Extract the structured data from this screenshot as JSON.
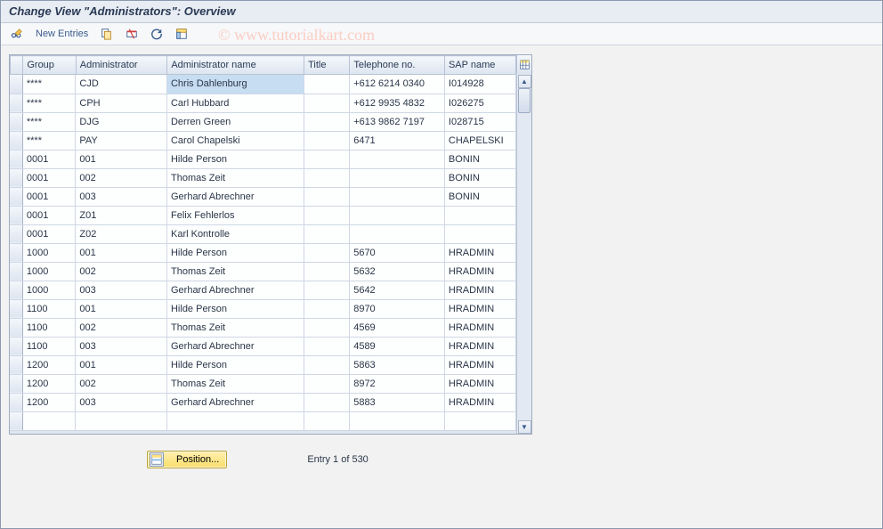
{
  "window_title": "Change View \"Administrators\": Overview",
  "watermark": "© www.tutorialkart.com",
  "toolbar": {
    "new_entries_label": "New Entries"
  },
  "columns": {
    "group": "Group",
    "admin": "Administrator",
    "name": "Administrator name",
    "title": "Title",
    "tel": "Telephone no.",
    "sap": "SAP name"
  },
  "rows": [
    {
      "group": "****",
      "admin": "CJD",
      "name": "Chris Dahlenburg",
      "title": "",
      "tel": "+612 6214 0340",
      "sap": "I014928"
    },
    {
      "group": "****",
      "admin": "CPH",
      "name": "Carl Hubbard",
      "title": "",
      "tel": "+612 9935 4832",
      "sap": "I026275"
    },
    {
      "group": "****",
      "admin": "DJG",
      "name": "Derren Green",
      "title": "",
      "tel": "+613 9862 7197",
      "sap": "I028715"
    },
    {
      "group": "****",
      "admin": "PAY",
      "name": "Carol Chapelski",
      "title": "",
      "tel": "6471",
      "sap": "CHAPELSKI"
    },
    {
      "group": "0001",
      "admin": "001",
      "name": "Hilde Person",
      "title": "",
      "tel": "",
      "sap": "BONIN"
    },
    {
      "group": "0001",
      "admin": "002",
      "name": "Thomas Zeit",
      "title": "",
      "tel": "",
      "sap": "BONIN"
    },
    {
      "group": "0001",
      "admin": "003",
      "name": "Gerhard Abrechner",
      "title": "",
      "tel": "",
      "sap": "BONIN"
    },
    {
      "group": "0001",
      "admin": "Z01",
      "name": "Felix Fehlerlos",
      "title": "",
      "tel": "",
      "sap": ""
    },
    {
      "group": "0001",
      "admin": "Z02",
      "name": "Karl Kontrolle",
      "title": "",
      "tel": "",
      "sap": ""
    },
    {
      "group": "1000",
      "admin": "001",
      "name": "Hilde Person",
      "title": "",
      "tel": "5670",
      "sap": "HRADMIN"
    },
    {
      "group": "1000",
      "admin": "002",
      "name": "Thomas Zeit",
      "title": "",
      "tel": "5632",
      "sap": "HRADMIN"
    },
    {
      "group": "1000",
      "admin": "003",
      "name": "Gerhard Abrechner",
      "title": "",
      "tel": "5642",
      "sap": "HRADMIN"
    },
    {
      "group": "1100",
      "admin": "001",
      "name": "Hilde Person",
      "title": "",
      "tel": "8970",
      "sap": "HRADMIN"
    },
    {
      "group": "1100",
      "admin": "002",
      "name": "Thomas Zeit",
      "title": "",
      "tel": "4569",
      "sap": "HRADMIN"
    },
    {
      "group": "1100",
      "admin": "003",
      "name": "Gerhard Abrechner",
      "title": "",
      "tel": "4589",
      "sap": "HRADMIN"
    },
    {
      "group": "1200",
      "admin": "001",
      "name": "Hilde Person",
      "title": "",
      "tel": "5863",
      "sap": "HRADMIN"
    },
    {
      "group": "1200",
      "admin": "002",
      "name": "Thomas Zeit",
      "title": "",
      "tel": "8972",
      "sap": "HRADMIN"
    },
    {
      "group": "1200",
      "admin": "003",
      "name": "Gerhard Abrechner",
      "title": "",
      "tel": "5883",
      "sap": "HRADMIN"
    }
  ],
  "footer": {
    "position_label": "Position...",
    "entry_text": "Entry 1 of 530"
  }
}
